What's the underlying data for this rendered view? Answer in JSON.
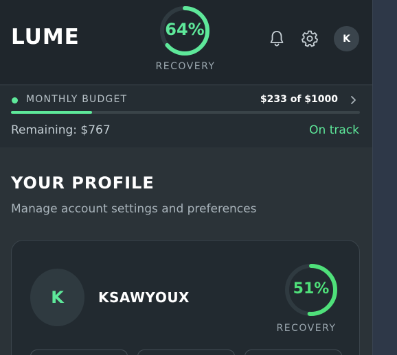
{
  "app": {
    "logo": "LUME",
    "avatar_initial": "K"
  },
  "header_recovery": {
    "percent_text": "64%",
    "percent": 64,
    "label": "RECOVERY"
  },
  "icons": {
    "notifications": "bell-icon",
    "settings": "gear-icon",
    "budget_chevron": "chevron-right-icon"
  },
  "budget": {
    "title": "MONTHLY BUDGET",
    "amount_text": "$233 of $1000",
    "spent": 233,
    "total": 1000,
    "remaining_text": "Remaining: $767",
    "status": "On track"
  },
  "profile": {
    "title": "YOUR PROFILE",
    "subtitle": "Manage account settings and preferences",
    "avatar_initial": "K",
    "username": "KSAWYOUX",
    "recovery": {
      "percent_text": "51%",
      "percent": 51,
      "label": "RECOVERY"
    }
  },
  "colors": {
    "accent_green": "#5ee89a",
    "ring_green": "#4fe07a",
    "background": "#2b3338",
    "header_bg": "#1f262c"
  }
}
